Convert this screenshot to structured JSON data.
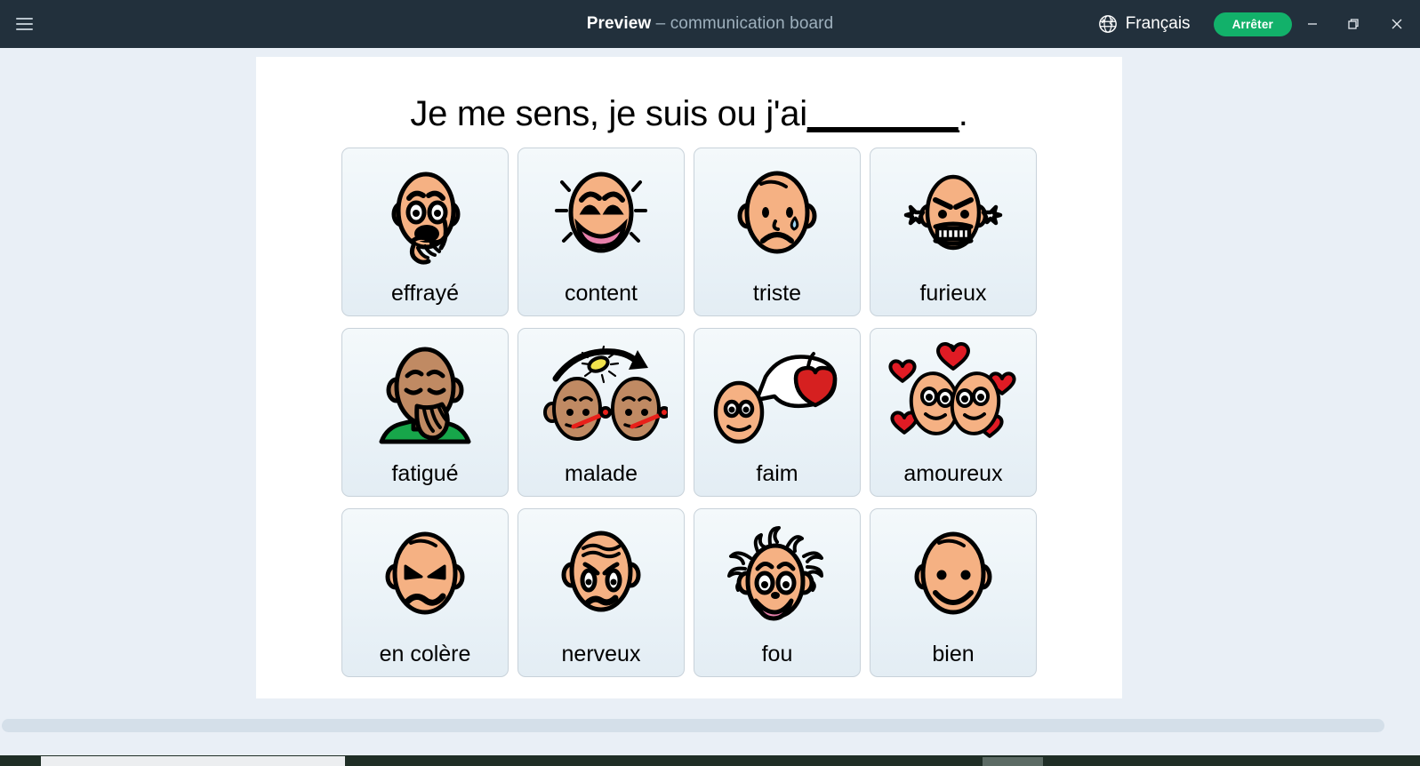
{
  "titlebar": {
    "menu_icon": "hamburger-menu-icon",
    "title_main": "Preview",
    "title_sub": " – communication board",
    "language_icon": "globe-icon",
    "language_label": "Français",
    "stop_label": "Arrêter",
    "minimize_icon": "minimize-icon",
    "maximize_icon": "restore-icon",
    "close_icon": "close-icon",
    "bg_color": "#22303c",
    "stop_color": "#12b16a"
  },
  "board": {
    "title": "Je me sens, je suis ou j'ai",
    "title_blank": "________",
    "title_end": ".",
    "cells": [
      {
        "label": "effrayé",
        "icon": "scared-face-icon"
      },
      {
        "label": "content",
        "icon": "happy-face-icon"
      },
      {
        "label": "triste",
        "icon": "sad-face-icon"
      },
      {
        "label": "furieux",
        "icon": "furious-face-icon"
      },
      {
        "label": "fatigué",
        "icon": "tired-yawning-face-icon"
      },
      {
        "label": "malade",
        "icon": "sick-contagion-icon"
      },
      {
        "label": "faim",
        "icon": "hungry-apple-thought-icon"
      },
      {
        "label": "amoureux",
        "icon": "in-love-hearts-icon"
      },
      {
        "label": "en colère",
        "icon": "angry-face-icon"
      },
      {
        "label": "nerveux",
        "icon": "nervous-face-icon"
      },
      {
        "label": "fou",
        "icon": "crazy-face-icon"
      },
      {
        "label": "bien",
        "icon": "fine-smiling-face-icon"
      }
    ]
  },
  "colors": {
    "page_bg": "#e9eff6",
    "sheet_bg": "#ffffff",
    "card_border": "#c8d2da",
    "skin_light": "#f5b183",
    "skin_dark": "#c08a63",
    "mouth_pink": "#e87fab",
    "heart_red": "#e01b24",
    "apple_red": "#d62020",
    "shirt_green": "#17a64a",
    "bug_yellow": "#f2e34c",
    "thermometer_red": "#e8201a"
  },
  "scrollbar": {
    "name": "horizontal-scrollbar"
  }
}
